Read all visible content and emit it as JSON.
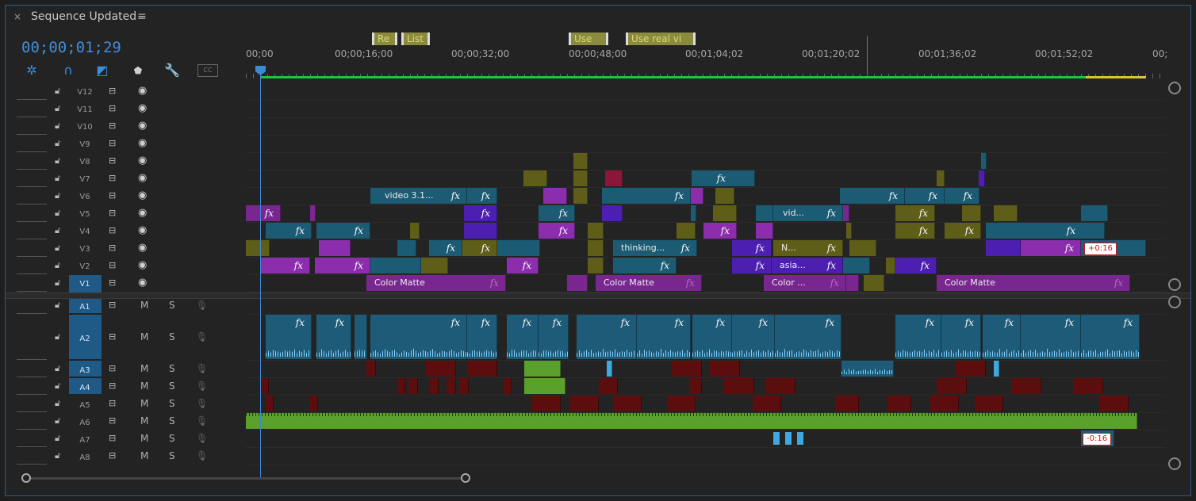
{
  "header": {
    "close_glyph": "×",
    "title": "Sequence Updated",
    "menu_glyph": "≡",
    "timecode": "00;00;01;29"
  },
  "toolbar": {
    "icons": [
      "nest-icon",
      "snap-magnet-icon",
      "linked-selection-icon",
      "add-marker-icon",
      "wrench-settings-icon",
      "closed-captions-icon"
    ],
    "cc_label": "CC"
  },
  "markers": [
    {
      "label": "Re"
    },
    {
      "label": "List"
    },
    {
      "label": "Use"
    },
    {
      "label": "Use real vi"
    }
  ],
  "ruler_ticks": [
    "00;00",
    "00;00;16;00",
    "00;00;32;00",
    "00;00;48;00",
    "00;01;04;02",
    "00;01;20;02",
    "00;01;36;02",
    "00;01;52;02",
    "00;"
  ],
  "video_tracks": [
    "V12",
    "V11",
    "V10",
    "V9",
    "V8",
    "V7",
    "V6",
    "V5",
    "V4",
    "V3",
    "V2",
    "V1"
  ],
  "audio_tracks": [
    "A1",
    "A2",
    "A3",
    "A4",
    "A5",
    "A6",
    "A7",
    "A8"
  ],
  "audio_buttons": {
    "mute": "M",
    "solo": "S"
  },
  "clips": {
    "fx": "fx",
    "v6_video": "video 3.1...",
    "v5_vid": "vid...",
    "v3_thinking": "thinking...",
    "v3_n": "N...",
    "v2_asia": "asia...",
    "v1_matte1": "Color Matte",
    "v1_matte2": "Color Matte",
    "v1_matte3": "Color ...",
    "v1_matte4": "Color Matte"
  },
  "badges": {
    "v3": "+0:16",
    "a7": "-0:16"
  },
  "colors": {
    "accent": "#3d8ee0",
    "teal_clip": "#1b5b73",
    "purple_clip": "#7a2691",
    "violet_clip": "#4c1fb0",
    "olive_clip": "#5e5e19",
    "maroon_clip": "#5c0d0d",
    "green_audio": "#5aa02c",
    "render_bar_green": "#22c23a",
    "render_bar_yellow": "#d8c23a"
  }
}
